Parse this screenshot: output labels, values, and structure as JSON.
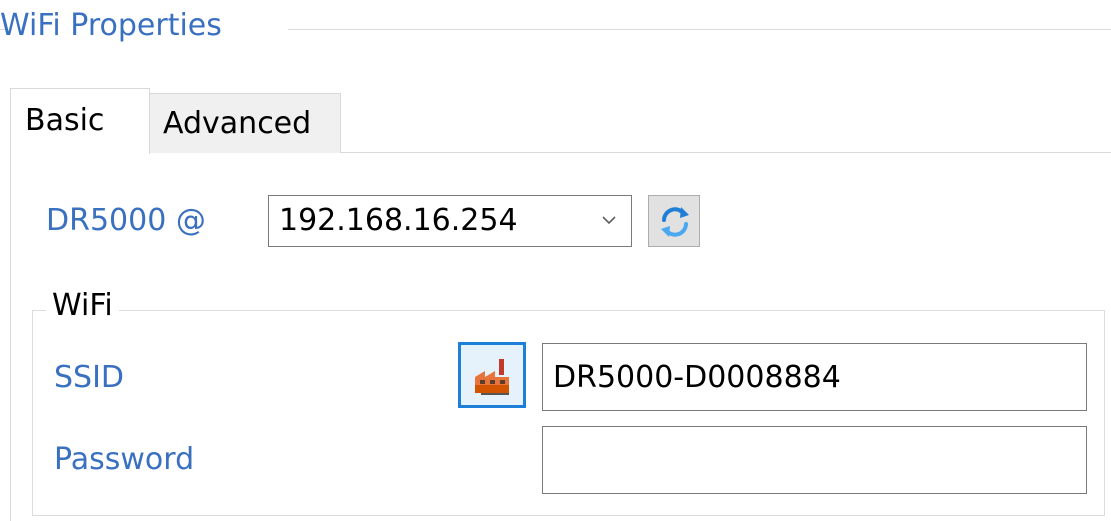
{
  "group": {
    "title": "WiFi Properties"
  },
  "tabs": [
    {
      "label": "Basic",
      "selected": true
    },
    {
      "label": "Advanced",
      "selected": false
    }
  ],
  "device": {
    "label": "DR5000 @",
    "selected_ip": "192.168.16.254",
    "refresh_icon": "refresh-icon"
  },
  "wifi": {
    "title": "WiFi",
    "ssid_label": "SSID",
    "ssid_value": "DR5000-D0008884",
    "factory_icon": "factory-icon",
    "password_label": "Password",
    "password_value": ""
  },
  "colors": {
    "label_blue": "#3a70c0",
    "focus_blue": "#1e7fd8",
    "border_gray": "#7a7a7a"
  }
}
